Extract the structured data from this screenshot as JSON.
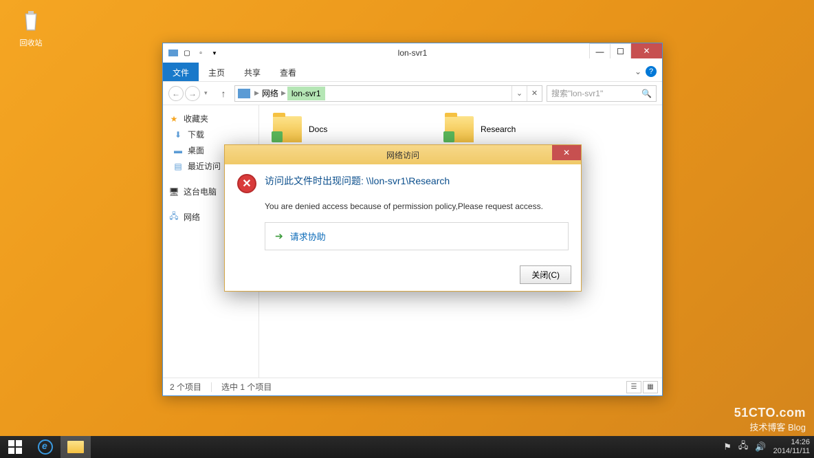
{
  "desktop": {
    "recycle_bin": "回收站"
  },
  "explorer": {
    "title": "lon-svr1",
    "tabs": {
      "file": "文件",
      "home": "主页",
      "share": "共享",
      "view": "查看"
    },
    "breadcrumb": {
      "network": "网络",
      "host": "lon-svr1"
    },
    "search_placeholder": "搜索\"lon-svr1\"",
    "sidebar": {
      "favorites": "收藏夹",
      "downloads": "下载",
      "desktop": "桌面",
      "recent": "最近访问",
      "this_pc": "这台电脑",
      "network": "网络"
    },
    "folders": [
      {
        "name": "Docs"
      },
      {
        "name": "Research"
      }
    ],
    "status": {
      "count": "2 个项目",
      "selected": "选中 1 个项目"
    }
  },
  "dialog": {
    "title": "网络访问",
    "heading": "访问此文件时出现问题: \\\\lon-svr1\\Research",
    "message": "You are denied access because of permission policy,Please request access.",
    "request": "请求协助",
    "close": "关闭(C)"
  },
  "taskbar": {
    "time": "14:26",
    "date": "2014/11/11"
  },
  "watermark": {
    "line1": "51CTO.com",
    "line2": "技术博客 Blog"
  }
}
